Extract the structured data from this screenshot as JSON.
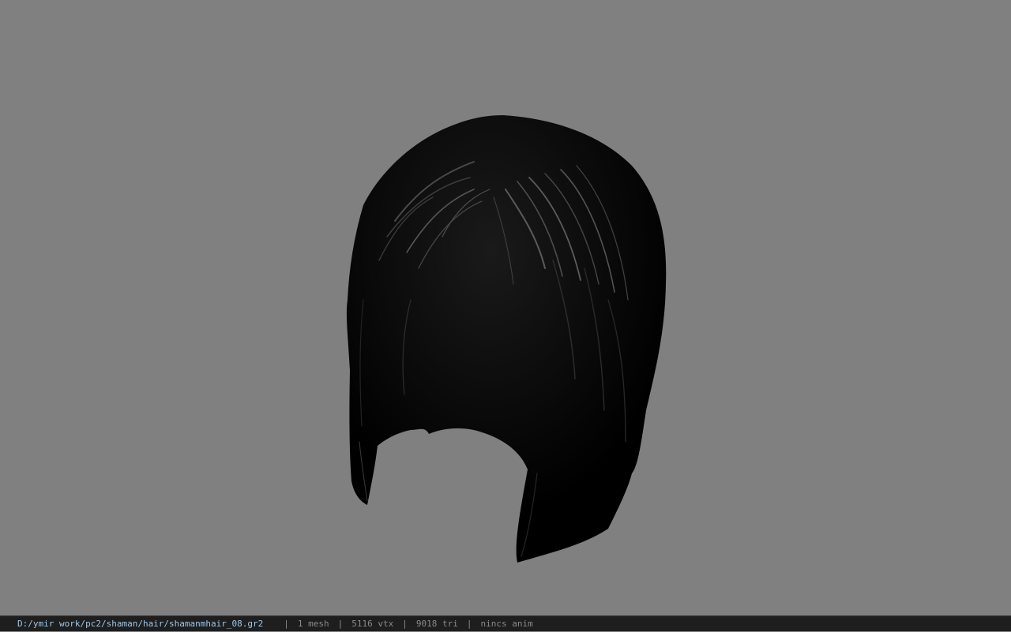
{
  "viewport": {
    "background_color": "#808080",
    "model": {
      "description_icon": "hair-mesh-render",
      "color": "#050505",
      "highlight_color": "#5a5a5a"
    }
  },
  "status_bar": {
    "file_path": "D:/ymir work/pc2/shaman/hair/shamanmhair_08.gr2",
    "separator": "|",
    "mesh_count": "1 mesh",
    "vertex_count": "5116 vtx",
    "triangle_count": "9018 tri",
    "anim_status": "nincs anim",
    "path_color": "#9fc7e6",
    "text_color": "#8a8a8a"
  }
}
